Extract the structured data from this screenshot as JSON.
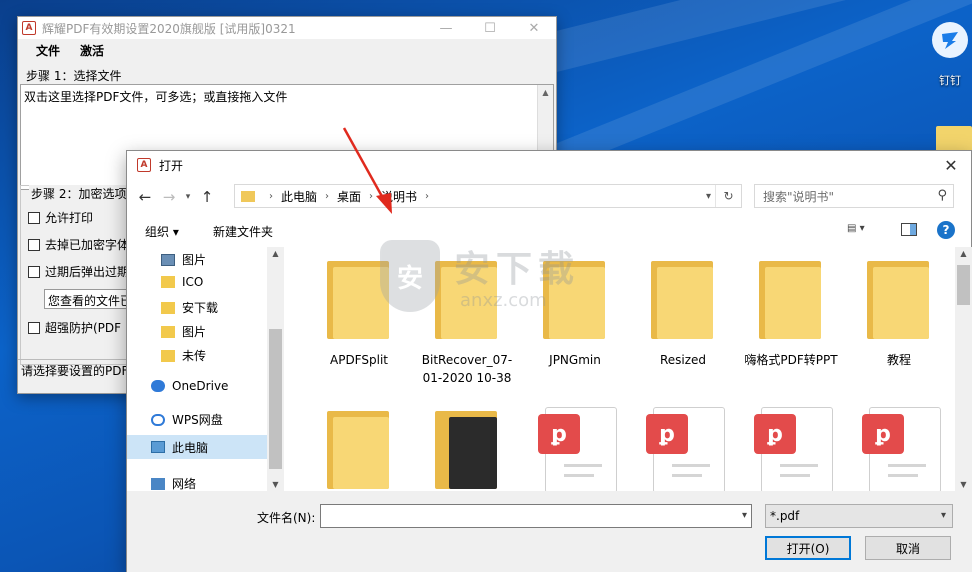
{
  "desktop": {
    "icon_label": "钉钉"
  },
  "app": {
    "title": "辉耀PDF有效期设置2020旗舰版 [试用版]0321",
    "menu": [
      "文件",
      "激活"
    ],
    "step1_label": "步骤 1：选择文件",
    "drop_hint": "双击这里选择PDF文件，可多选；或直接拖入文件",
    "step2_label": "步骤 2：加密选项",
    "options": [
      "允许打印",
      "去掉已加密字体",
      "过期后弹出过期",
      "超强防护(PDF"
    ],
    "input_value": "您查看的文件已",
    "status": "请选择要设置的PDF"
  },
  "dialog": {
    "title": "打开",
    "breadcrumb": [
      "此电脑",
      "桌面",
      "说明书"
    ],
    "search_placeholder": "搜索\"说明书\"",
    "toolbar": {
      "organize": "组织 ▾",
      "new_folder": "新建文件夹"
    },
    "nav_items": [
      {
        "label": "图片",
        "icon": "picture-icon"
      },
      {
        "label": "ICO",
        "icon": "folder-icon"
      },
      {
        "label": "安下载",
        "icon": "folder-icon"
      },
      {
        "label": "图片",
        "icon": "folder-icon"
      },
      {
        "label": "未传",
        "icon": "folder-icon"
      },
      {
        "label": "OneDrive",
        "icon": "onedrive-icon"
      },
      {
        "label": "WPS网盘",
        "icon": "cloud-icon"
      },
      {
        "label": "此电脑",
        "icon": "computer-icon"
      },
      {
        "label": "网络",
        "icon": "network-icon"
      }
    ],
    "files_row1": [
      {
        "name": "APDFSplit",
        "type": "folder"
      },
      {
        "name": "BitRecover_07-01-2020 10-38",
        "type": "folder"
      },
      {
        "name": "JPNGmin",
        "type": "folder"
      },
      {
        "name": "Resized",
        "type": "folder"
      },
      {
        "name": "嗨格式PDF转PPT",
        "type": "folder"
      },
      {
        "name": "教程",
        "type": "folder"
      }
    ],
    "files_row2": [
      {
        "type": "folder"
      },
      {
        "type": "folder"
      },
      {
        "type": "pdf"
      },
      {
        "type": "pdf"
      },
      {
        "type": "pdf"
      },
      {
        "type": "pdf"
      }
    ],
    "filename_label": "文件名(N):",
    "filename_value": "",
    "filetype": "*.pdf",
    "open_button": "打开(O)",
    "cancel_button": "取消"
  },
  "watermark": {
    "text": "安下载",
    "sub": "anxz.com"
  },
  "colors": {
    "accent": "#0078d7",
    "arrow": "#e02a1e",
    "folder": "#f8d775",
    "pdf_badge": "#e34b4b"
  }
}
